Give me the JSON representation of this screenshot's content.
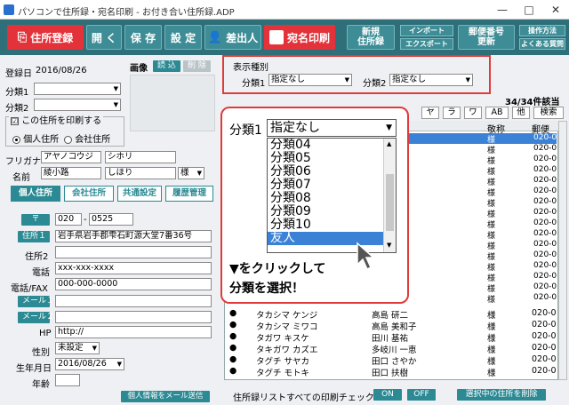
{
  "window": {
    "title": "パソコンで住所録・宛名印刷 - お付き合い住所録.ADP",
    "minimize": "—",
    "maximize": "□",
    "close": "✕"
  },
  "toolbar": {
    "register": "住所登録",
    "open": "開 く",
    "save": "保 存",
    "settings": "設 定",
    "sender": "差出人",
    "label_print": "宛名印刷",
    "new_book_line1": "新規",
    "new_book_line2": "住所録",
    "import": "インポート",
    "export": "エクスポート",
    "zip_line1": "郵便番号",
    "zip_line2": "更新",
    "howto": "操作方法",
    "faq": "よくある質問"
  },
  "form": {
    "reg_date_label": "登録日",
    "reg_date_value": "2016/08/26",
    "image_label": "画像",
    "load_btn": "読 込",
    "delete_btn": "削 除",
    "cat1_label": "分類1",
    "cat2_label": "分類2",
    "print_group_label": "この住所を印刷する",
    "print_check": "☑",
    "radio_personal": "個人住所",
    "radio_company": "会社住所",
    "furigana_label": "フリガナ",
    "furigana_last": "アヤノコウジ",
    "furigana_first": "シホリ",
    "name_label": "名前",
    "name_last": "綾小路",
    "name_first": "しほり",
    "honorific": "様",
    "tab_personal": "個人住所",
    "tab_company": "会社住所",
    "tab_common": "共通設定",
    "tab_history": "履歴管理",
    "zip_tag": "〒",
    "zip1": "020",
    "zip2": "0525",
    "addr1_tag": "住所１",
    "addr1": "岩手県岩手郡雫石町源大堂7番36号",
    "addr2_label": "住所2",
    "phone_label": "電話",
    "phone": "xxx-xxx-xxxx",
    "fax_label": "電話/FAX",
    "fax": "000-000-0000",
    "mail1_tag": "メール１",
    "mail2_tag": "メール２",
    "hp_label": "HP",
    "hp": "http://",
    "gender_label": "性別",
    "gender": "未設定",
    "birth_label": "生年月日",
    "birth": "2016/08/26",
    "age_label": "年齢",
    "send_mail_btn": "個人情報をメール送信"
  },
  "display_kind": {
    "label": "表示種別",
    "cat1_label": "分類1",
    "cat1_value": "指定なし",
    "cat2_label": "分類2",
    "cat2_value": "指定なし"
  },
  "list": {
    "count": "34/34件該当",
    "tabs": [
      "ヤ",
      "ラ",
      "ワ",
      "AB",
      "他",
      "検索"
    ],
    "headers": [
      "敬称",
      "郵便"
    ],
    "rows": [
      {
        "mark": "●",
        "kana": "タカシマ ケンジ",
        "name": "高島 研二",
        "hon": "様",
        "zip": "020-0"
      },
      {
        "mark": "●",
        "kana": "タカシマ ミワコ",
        "name": "高島 美和子",
        "hon": "様",
        "zip": "020-0"
      },
      {
        "mark": "●",
        "kana": "タガワ キスケ",
        "name": "田川 基祐",
        "hon": "様",
        "zip": "020-0"
      },
      {
        "mark": "●",
        "kana": "タキガワ カズエ",
        "name": "多岐川 一恵",
        "hon": "様",
        "zip": "020-0"
      },
      {
        "mark": "●",
        "kana": "タグチ サヤカ",
        "name": "田口 さやか",
        "hon": "様",
        "zip": "020-0"
      },
      {
        "mark": "●",
        "kana": "タグチ モトキ",
        "name": "田口 扶樹",
        "hon": "様",
        "zip": "020-0"
      }
    ],
    "upper_hon": [
      "様",
      "様",
      "様",
      "様",
      "様",
      "様",
      "様",
      "様",
      "様",
      "様",
      "様",
      "様",
      "様",
      "様",
      "様",
      "様"
    ],
    "upper_zip": [
      "020-0",
      "020-0",
      "020-0",
      "020-0",
      "020-0",
      "020-0",
      "020-0",
      "020-0",
      "020-0",
      "020-0",
      "020-0",
      "020-0",
      "020-0",
      "020-0",
      "020-0",
      "020-0"
    ]
  },
  "bottom": {
    "print_check_label": "住所録リストすべての印刷チェック:",
    "on": "ON",
    "off": "OFF",
    "delete_selected": "選択中の住所を削除"
  },
  "callout": {
    "label": "分類1",
    "selected": "指定なし",
    "options": [
      "分類04",
      "分類05",
      "分類06",
      "分類07",
      "分類08",
      "分類09",
      "分類10",
      "友人"
    ],
    "highlighted": "友人",
    "instruction_line1": "▼をクリックして",
    "instruction_line2": "分類を選択！"
  },
  "colors": {
    "teal": "#2f6f7a",
    "accent_red": "#e03b3b",
    "highlight": "#3b82d6"
  }
}
